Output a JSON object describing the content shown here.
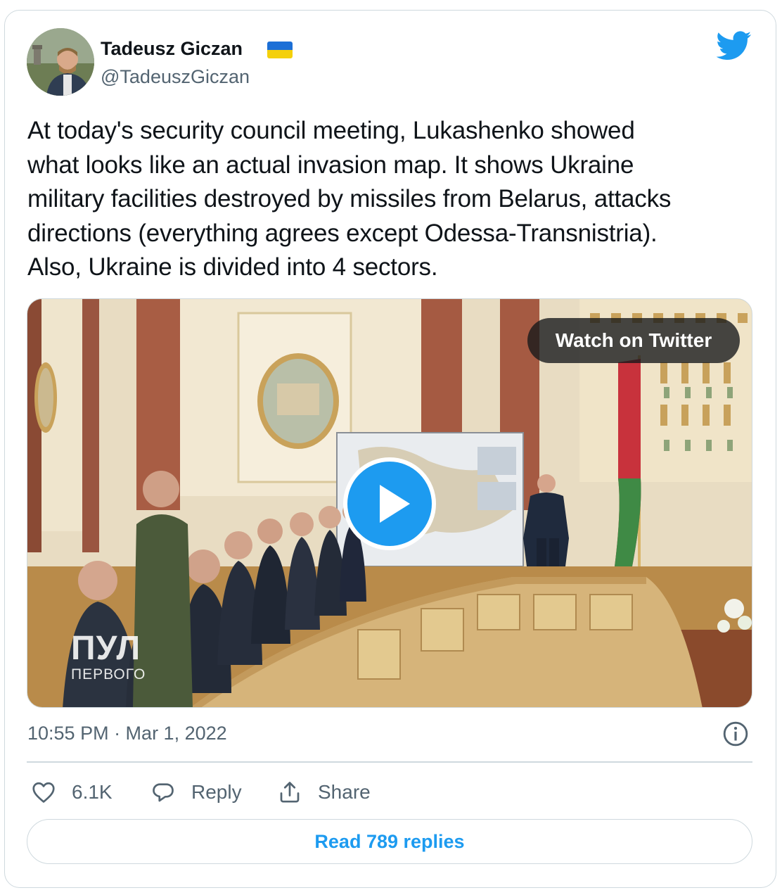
{
  "author": {
    "name": "Tadeusz Giczan",
    "handle": "@TadeuszGiczan",
    "flag_icon": "ukraine-flag-icon",
    "avatar_icon": "profile-photo"
  },
  "brand": {
    "icon": "twitter-bird-icon",
    "color": "#1d9bf0"
  },
  "tweet": {
    "text": "At today's security council meeting, Lukashenko showed\nwhat looks like an actual invasion map. It shows Ukraine\nmilitary facilities destroyed by missiles from Belarus, attacks\ndirections (everything agrees except Odessa-Transnistria).\nAlso, Ukraine is divided into 4 sectors."
  },
  "media": {
    "watch_label": "Watch on Twitter",
    "play_icon": "play-icon",
    "watermark_big": "ПУЛ",
    "watermark_small": "ПЕРВОГО"
  },
  "meta": {
    "timestamp": "10:55 PM · Mar 1, 2022",
    "info_icon": "info-icon"
  },
  "actions": {
    "like_count": "6.1K",
    "reply_label": "Reply",
    "share_label": "Share"
  },
  "read_replies_label": "Read 789 replies",
  "colors": {
    "text": "#0f1419",
    "secondary": "#536471",
    "border": "#cfd9de",
    "link": "#1d9bf0"
  }
}
